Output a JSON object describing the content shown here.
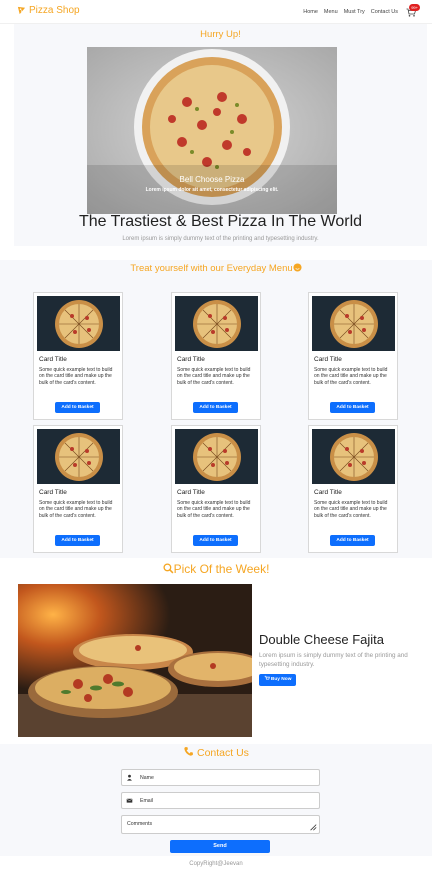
{
  "navbar": {
    "brand": "Pizza Shop",
    "links": [
      "Home",
      "Menu",
      "Must Try",
      "Contact Us"
    ],
    "cart_count": "99+"
  },
  "hero": {
    "hurry": "Hurry Up!",
    "caption_title": "Bell Choose Pizza",
    "caption_text": "Lorem ipsum dolor sit amet, consectetur adipiscing elit.",
    "title": "The Trastiest & Best Pizza In The World",
    "subtitle": "Lorem ipsum is simply dummy text of the printing and typesetting industry."
  },
  "menu": {
    "title": "Treat yourself with our Everyday Menu",
    "cards": [
      {
        "title": "Card Title",
        "text": "Some quick example text to build on the card title and make up the bulk of the card's content.",
        "button": "Add to Basket"
      },
      {
        "title": "Card Title",
        "text": "Some quick example text to build on the card title and make up the bulk of the card's content.",
        "button": "Add to Basket"
      },
      {
        "title": "Card Title",
        "text": "Some quick example text to build on the card title and make up the bulk of the card's content.",
        "button": "Add to Basket"
      },
      {
        "title": "Card Title",
        "text": "Some quick example text to build on the card title and make up the bulk of the card's content.",
        "button": "Add to Basket"
      },
      {
        "title": "Card Title",
        "text": "Some quick example text to build on the card title and make up the bulk of the card's content.",
        "button": "Add to Basket"
      },
      {
        "title": "Card Title",
        "text": "Some quick example text to build on the card title and make up the bulk of the card's content.",
        "button": "Add to Basket"
      }
    ]
  },
  "pick": {
    "title": "Pick Of the Week!",
    "name": "Double Cheese Fajita",
    "desc": "Lorem ipsum is simply dummy text of the printing and typesetting industry.",
    "button": "Buy Now"
  },
  "contact": {
    "title": "Contact Us",
    "name_placeholder": "Name",
    "email_placeholder": "Email",
    "comments_placeholder": "Comments",
    "send": "Send"
  },
  "footer": {
    "text": "CopyRight@Jeevan"
  },
  "colors": {
    "accent": "#f5a623",
    "button": "#0d6efd",
    "section_bg": "#f7f8fb"
  },
  "icons": {
    "brand": "pizza-slice-icon",
    "cart": "shopping-cart-icon",
    "menu_emoji": "smiley-icon",
    "pick": "search-icon",
    "contact": "phone-icon",
    "name": "user-icon",
    "email": "envelope-icon",
    "buy": "cart-icon"
  }
}
